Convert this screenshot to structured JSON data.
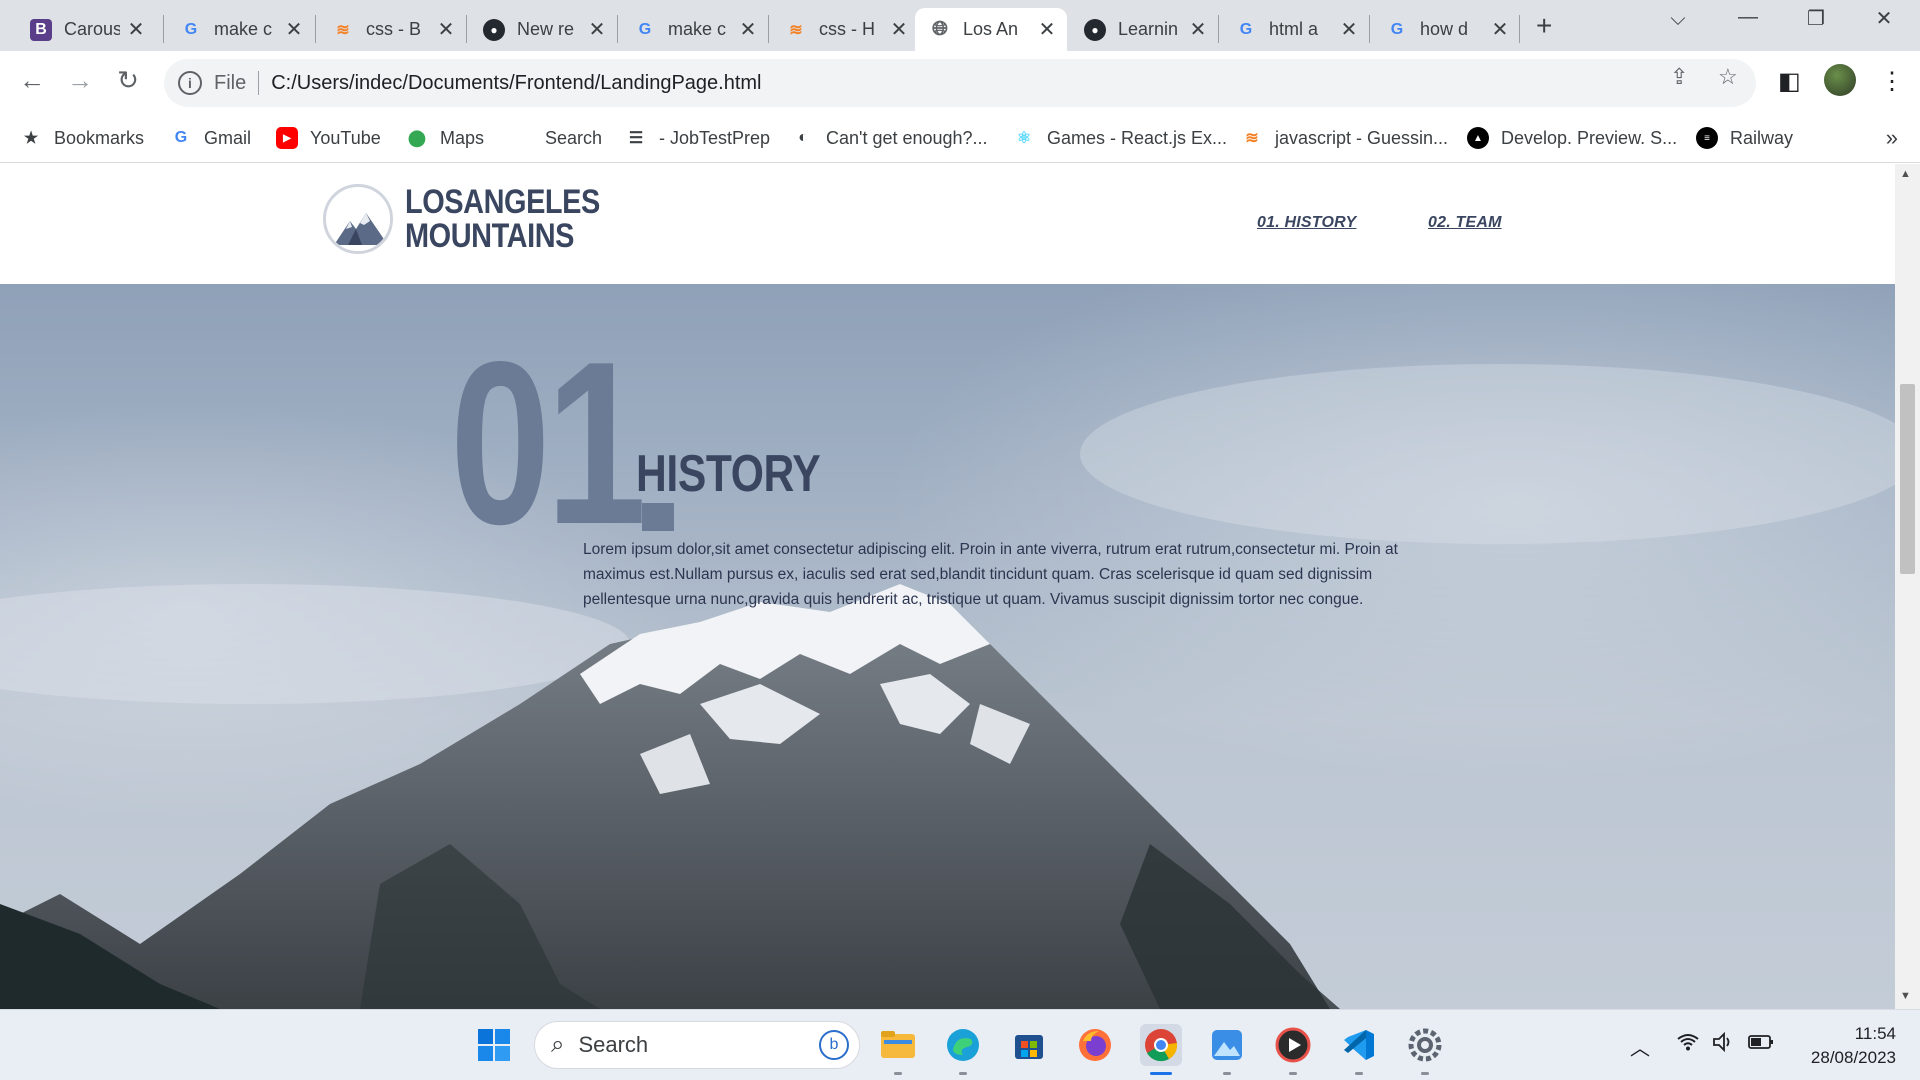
{
  "browser": {
    "tabs": [
      {
        "title": "Carous",
        "favicon": "B"
      },
      {
        "title": "make c",
        "favicon": "G"
      },
      {
        "title": "css - B",
        "favicon": "S"
      },
      {
        "title": "New re",
        "favicon": "GH"
      },
      {
        "title": "make c",
        "favicon": "G"
      },
      {
        "title": "css - H",
        "favicon": "S"
      },
      {
        "title": "Los An",
        "favicon": "globe",
        "active": true
      },
      {
        "title": "Learnin",
        "favicon": "GH"
      },
      {
        "title": "html a",
        "favicon": "G"
      },
      {
        "title": "how d",
        "favicon": "G"
      }
    ],
    "address": {
      "scheme": "File",
      "url": "C:/Users/indec/Documents/Frontend/LandingPage.html"
    },
    "bookmarks": [
      {
        "label": "Bookmarks",
        "icon": "star-icon"
      },
      {
        "label": "Gmail",
        "icon": "google-icon"
      },
      {
        "label": "YouTube",
        "icon": "youtube-icon"
      },
      {
        "label": "Maps",
        "icon": "maps-pin-icon"
      },
      {
        "label": "Search",
        "icon": "none"
      },
      {
        "label": "- JobTestPrep",
        "icon": "menu-lines-icon"
      },
      {
        "label": "Can't get enough?...",
        "icon": "globe-icon"
      },
      {
        "label": "Games - React.js Ex...",
        "icon": "react-icon"
      },
      {
        "label": "javascript - Guessin...",
        "icon": "stackoverflow-icon"
      },
      {
        "label": "Develop. Preview. S...",
        "icon": "vercel-icon"
      },
      {
        "label": "Railway",
        "icon": "railway-icon"
      }
    ],
    "bookmarks_more": "»"
  },
  "site": {
    "logo_line1": "LOSANGELES",
    "logo_line2": "MOUNTAINS",
    "nav": [
      {
        "label": "01. HISTORY"
      },
      {
        "label": "02. TEAM"
      }
    ],
    "section": {
      "number": "01",
      "title": "HISTORY",
      "body": "Lorem ipsum dolor,sit amet consectetur adipiscing elit. Proin in ante viverra, rutrum erat rutrum,consectetur mi. Proin at maximus est.Nullam pursus ex, iaculis sed erat sed,blandit tincidunt quam. Cras scelerisque id quam sed dignissim pellentesque urna nunc,gravida quis hendrerit ac, tristique ut quam. Vivamus suscipit dignissim tortor nec congue."
    }
  },
  "taskbar": {
    "search_placeholder": "Search",
    "apps": [
      "windows-start-icon",
      "file-explorer-icon",
      "edge-icon",
      "microsoft-store-icon",
      "firefox-icon",
      "chrome-icon",
      "photos-icon",
      "media-player-icon",
      "vscode-icon",
      "settings-icon"
    ],
    "time": "11:54",
    "date": "28/08/2023"
  },
  "colors": {
    "brand_navy": "#3a4660",
    "number_slate": "#6b7a95",
    "chrome_tabbar": "#dee1e6"
  }
}
